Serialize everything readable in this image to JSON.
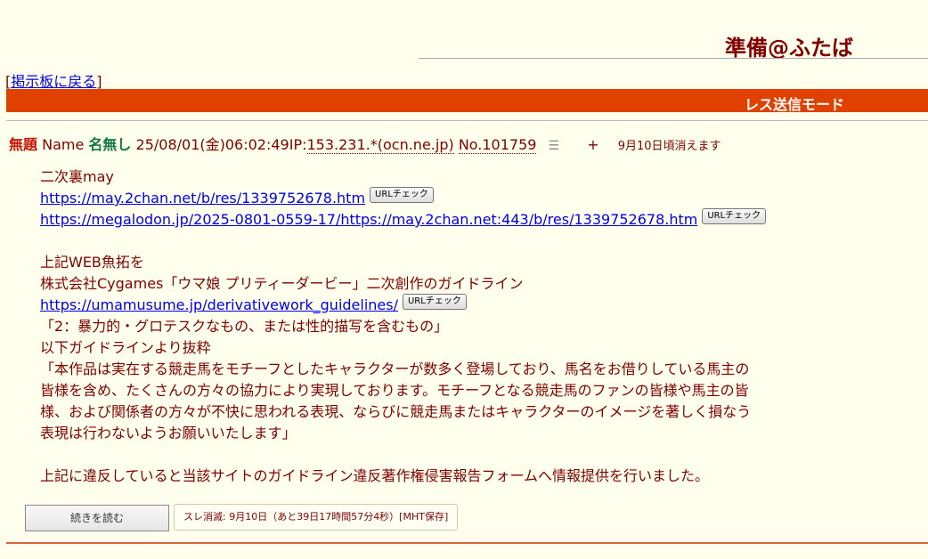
{
  "board_title": "準備@ふたば",
  "nav": {
    "back_bracket_open": "[",
    "back_label": "掲示板に戻る",
    "back_bracket_close": "]"
  },
  "mode_bar": {
    "label": "レス送信モード"
  },
  "post": {
    "subject": "無題",
    "name_label": "Name",
    "poster": "名無し",
    "datetime": "25/08/01(金)06:02:49",
    "ip_label": "IP:",
    "ip_value": "153.231.*(ocn.ne.jp)",
    "number": "No.101759",
    "plus": "+",
    "expiry": "9月10日頃消えます",
    "lines": {
      "l1": "二次裏may",
      "url1": "https://may.2chan.net/b/res/1339752678.htm",
      "url2": "https://megalodon.jp/2025-0801-0559-17/https://may.2chan.net:443/b/res/1339752678.htm",
      "l4": "上記WEB魚拓を",
      "l5": "株式会社Cygames「ウマ娘 プリティーダービー」二次創作のガイドライン",
      "url3": "https://umamusume.jp/derivativework_guidelines/",
      "l7": "「2：暴力的・グロテスクなもの、または性的描写を含むもの」",
      "l8": "以下ガイドラインより抜粋",
      "l9": "「本作品は実在する競走馬をモチーフとしたキャラクターが数多く登場しており、馬名をお借りしている馬主の",
      "l10": "皆様を含め、たくさんの方々の協力により実現しております。モチーフとなる競走馬のファンの皆様や馬主の皆",
      "l11": "様、および関係者の方々が不快に思われる表現、ならびに競走馬またはキャラクターのイメージを著しく損なう",
      "l12": "表現は行わないようお願いいたします」",
      "l14": "上記に違反していると当該サイトのガイドライン違反著作権侵害報告フォームへ情報提供を行いました。"
    },
    "url_check_label": "URLチェック"
  },
  "footer": {
    "continue_label": "続きを読む",
    "expire_info": "スレ消滅: 9月10日（あと39日17時間57分4秒）[MHT保存]"
  },
  "colors": {
    "background": "#ffffee",
    "text": "#800000",
    "accent_bar": "#e04000",
    "subject": "#cc1105",
    "poster": "#117743"
  },
  "icons": {
    "menu": "list-icon"
  }
}
